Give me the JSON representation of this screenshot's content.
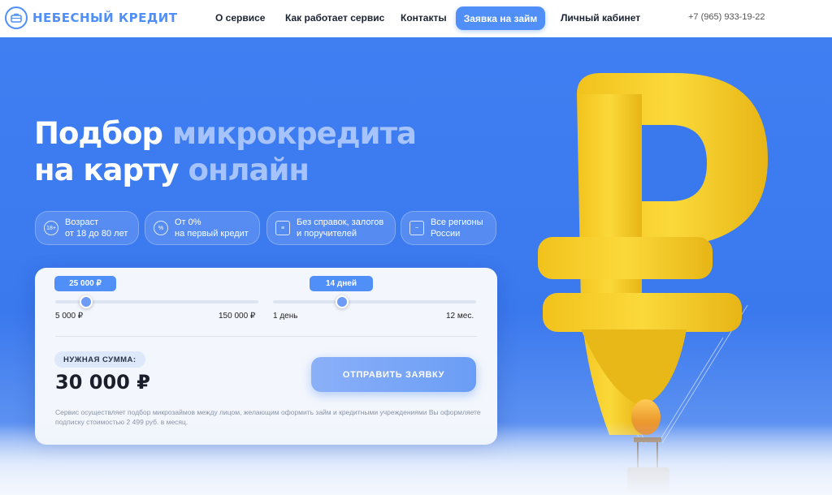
{
  "header": {
    "logo_text": "НЕБЕСНЫЙ КРЕДИТ",
    "nav": [
      "О сервисе",
      "Как работает сервис",
      "Контакты"
    ],
    "cta": "Заявка на займ",
    "cabinet": "Личный кабинет",
    "phone": "+7 (965) 933-19-22"
  },
  "hero": {
    "title_line1_plain": "Подбор ",
    "title_line1_accent": "микрокредита",
    "title_line2_plain": "на карту ",
    "title_line2_accent": "онлайн",
    "features": [
      {
        "icon": "18-plus-icon",
        "icon_text": "18+",
        "line1": "Возраст",
        "line2": "от 18 до 80 лет"
      },
      {
        "icon": "percent-icon",
        "icon_text": "%",
        "line1": "От 0%",
        "line2": "на первый кредит"
      },
      {
        "icon": "document-icon",
        "icon_text": "≡",
        "line1": "Без справок, залогов",
        "line2": "и поручителей"
      },
      {
        "icon": "russia-map-icon",
        "icon_text": "~",
        "line1": "Все регионы",
        "line2": "России"
      }
    ]
  },
  "calculator": {
    "amount_slider": {
      "value_label": "25 000 ₽",
      "min_label": "5 000 ₽",
      "max_label": "150 000 ₽",
      "min": 5000,
      "max": 150000,
      "value": 25000
    },
    "term_slider": {
      "value_label": "14 дней",
      "min_label": "1 день",
      "max_label": "12 мес.",
      "position_fraction": 0.34
    },
    "need_label": "НУЖНАЯ СУММА:",
    "amount": "30 000 ₽",
    "submit_label": "ОТПРАВИТЬ ЗАЯВКУ",
    "disclaimer": "Сервис осуществляет подбор микрозаймов между лицом, желающим оформить займ и кредитными учреждениями Вы оформляете подписку стоимостью 2 499 руб. в месяц."
  },
  "colors": {
    "accent": "#4f8ff7",
    "hero_bg": "#3f7ff2",
    "balloon": "#f6cf2a"
  }
}
